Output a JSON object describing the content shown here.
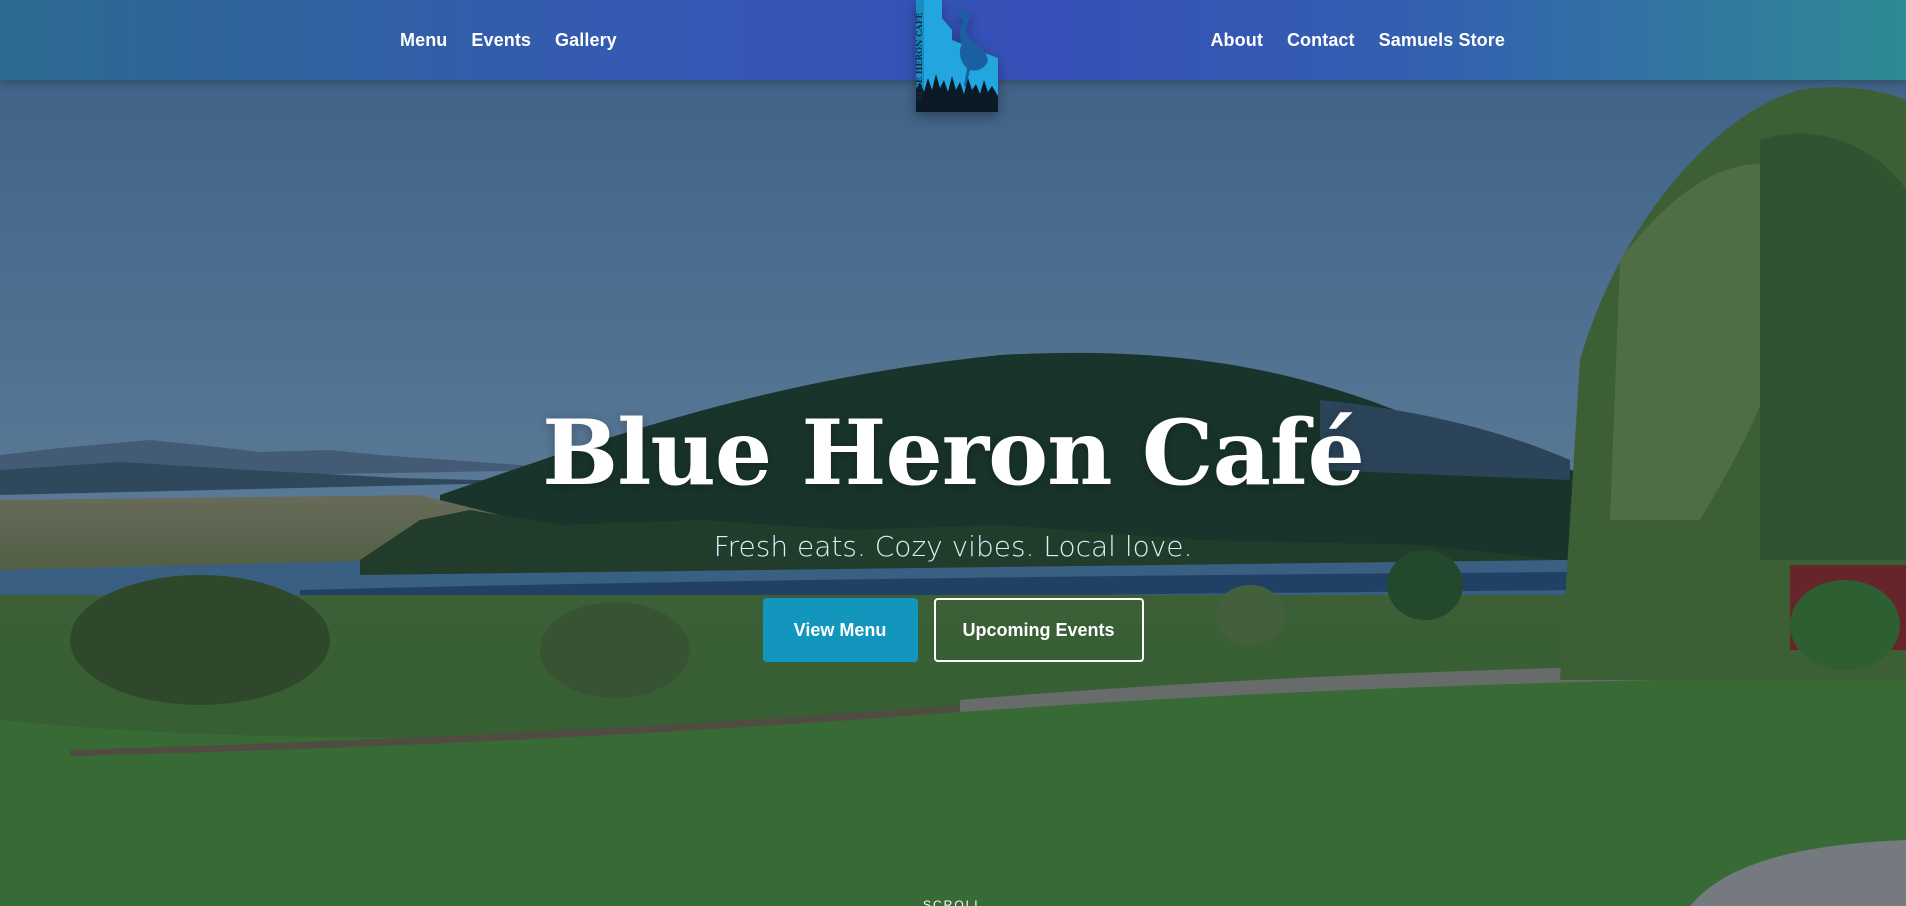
{
  "nav": {
    "left": [
      {
        "label": "Menu"
      },
      {
        "label": "Events"
      },
      {
        "label": "Gallery"
      }
    ],
    "right": [
      {
        "label": "About"
      },
      {
        "label": "Contact"
      },
      {
        "label": "Samuels Store"
      }
    ]
  },
  "logo": {
    "text": "BLUE HERON CAFE",
    "icon": "heron-idaho-logo"
  },
  "hero": {
    "title": "Blue Heron Café",
    "tagline": "Fresh eats. Cozy vibes. Local love.",
    "primary_button": "View Menu",
    "secondary_button": "Upcoming Events",
    "scroll_hint": "SCROLL"
  },
  "colors": {
    "nav_gradient_mid": "#3550b8",
    "primary_button": "#1396be",
    "tagline": "#d9f0fa"
  }
}
